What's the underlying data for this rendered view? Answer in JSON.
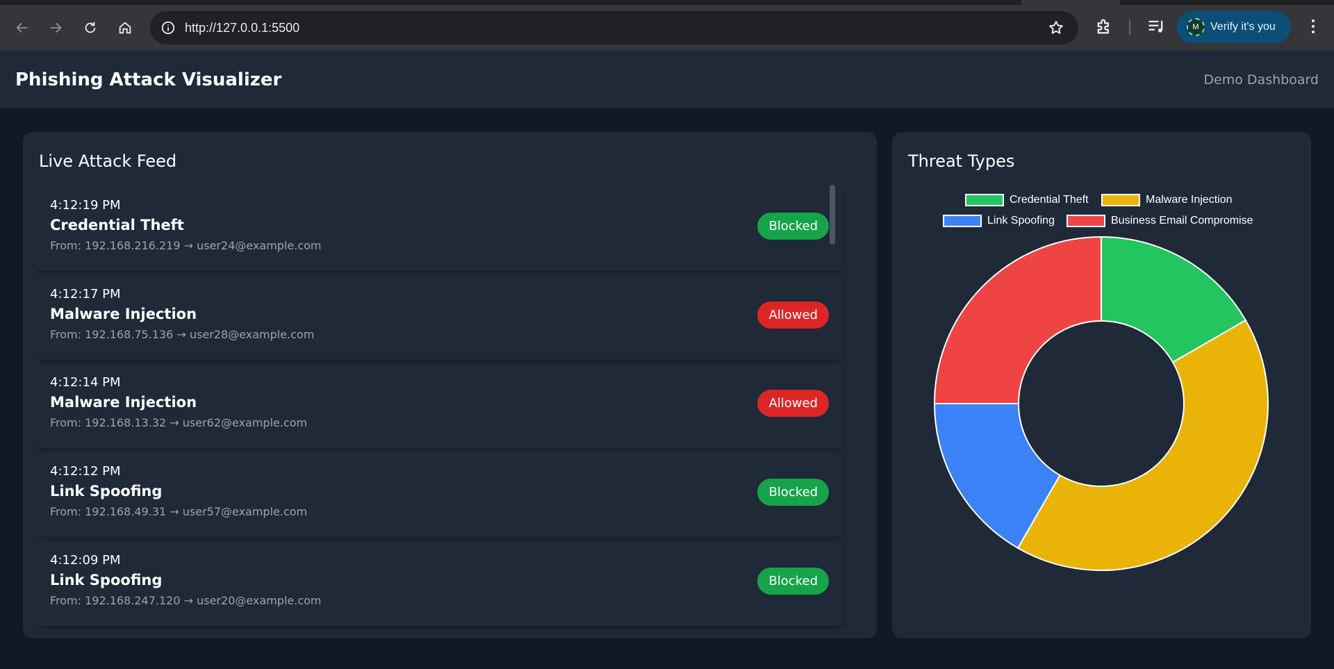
{
  "browser": {
    "url": "http://127.0.0.1:5500",
    "profile_initial": "M",
    "profile_action": "Verify it's you",
    "icons": [
      "back-icon",
      "forward-icon",
      "reload-icon",
      "home-icon",
      "site-info-icon",
      "bookmark-star-icon",
      "extensions-icon",
      "media-controls-icon",
      "menu-icon"
    ]
  },
  "header": {
    "title": "Phishing Attack Visualizer",
    "subtitle": "Demo Dashboard"
  },
  "feed": {
    "title": "Live Attack Feed",
    "items": [
      {
        "time": "4:12:19 PM",
        "type": "Credential Theft",
        "from": "From: 192.168.216.219 → user24@example.com",
        "status": "Blocked"
      },
      {
        "time": "4:12:17 PM",
        "type": "Malware Injection",
        "from": "From: 192.168.75.136 → user28@example.com",
        "status": "Allowed"
      },
      {
        "time": "4:12:14 PM",
        "type": "Malware Injection",
        "from": "From: 192.168.13.32 → user62@example.com",
        "status": "Allowed"
      },
      {
        "time": "4:12:12 PM",
        "type": "Link Spoofing",
        "from": "From: 192.168.49.31 → user57@example.com",
        "status": "Blocked"
      },
      {
        "time": "4:12:09 PM",
        "type": "Link Spoofing",
        "from": "From: 192.168.247.120 → user20@example.com",
        "status": "Blocked"
      }
    ],
    "status_colors": {
      "Blocked": "#16a34a",
      "Allowed": "#dc2626"
    }
  },
  "chart_panel": {
    "title": "Threat Types"
  },
  "chart_data": {
    "type": "pie",
    "variant": "doughnut",
    "title": "",
    "categories": [
      "Credential Theft",
      "Malware Injection",
      "Link Spoofing",
      "Business Email Compromise"
    ],
    "values": [
      2,
      5,
      2,
      3
    ],
    "colors": [
      "#22c55e",
      "#eab308",
      "#3b82f6",
      "#ef4444"
    ],
    "legend": "top"
  }
}
